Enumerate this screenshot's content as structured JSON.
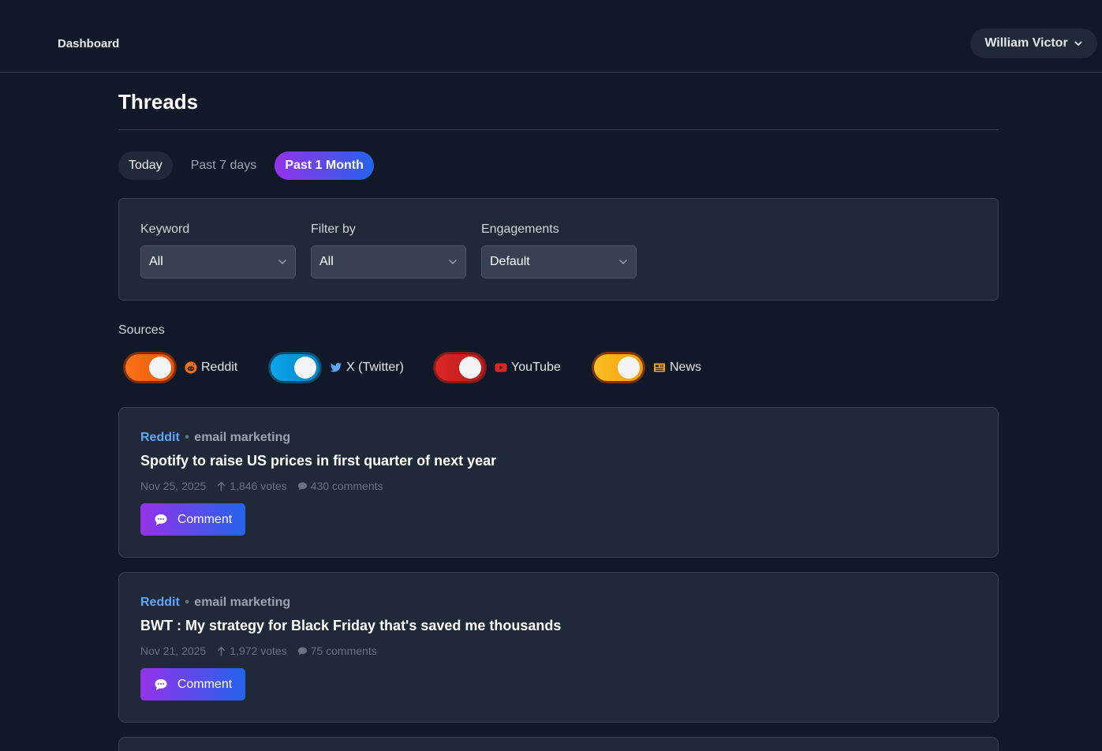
{
  "nav": {
    "dashboard_label": "Dashboard"
  },
  "user": {
    "name": "William Victor"
  },
  "page": {
    "title": "Threads"
  },
  "time_tabs": [
    {
      "label": "Today",
      "state": "default"
    },
    {
      "label": "Past 7 days",
      "state": "inactive"
    },
    {
      "label": "Past 1 Month",
      "state": "active"
    }
  ],
  "filters": {
    "keyword": {
      "label": "Keyword",
      "value": "All"
    },
    "filter_by": {
      "label": "Filter by",
      "value": "All"
    },
    "engagements": {
      "label": "Engagements",
      "value": "Default"
    }
  },
  "sources": {
    "label": "Sources",
    "items": [
      {
        "name": "Reddit",
        "enabled": true,
        "color": "#f97316",
        "icon": "reddit-icon"
      },
      {
        "name": "X (Twitter)",
        "enabled": true,
        "color": "#0ea5e9",
        "icon": "twitter-bird-icon"
      },
      {
        "name": "YouTube",
        "enabled": true,
        "color": "#dc2626",
        "icon": "youtube-icon"
      },
      {
        "name": "News",
        "enabled": true,
        "color": "#f59e0b",
        "icon": "newspaper-icon"
      }
    ]
  },
  "posts": [
    {
      "source": "Reddit",
      "separator": "•",
      "keyword": "email marketing",
      "title": "Spotify to raise US prices in first quarter of next year",
      "date": "Nov 25, 2025",
      "votes": "1,846 votes",
      "comments": "430 comments",
      "action_label": "Comment"
    },
    {
      "source": "Reddit",
      "separator": "•",
      "keyword": "email marketing",
      "title": "BWT : My strategy for Black Friday that's saved me thousands",
      "date": "Nov 21, 2025",
      "votes": "1,972 votes",
      "comments": "75 comments",
      "action_label": "Comment"
    }
  ],
  "colors": {
    "background": "#111827",
    "card": "#1f2937",
    "accent_gradient_start": "#9333ea",
    "accent_gradient_end": "#2563eb",
    "link": "#60a5fa"
  }
}
